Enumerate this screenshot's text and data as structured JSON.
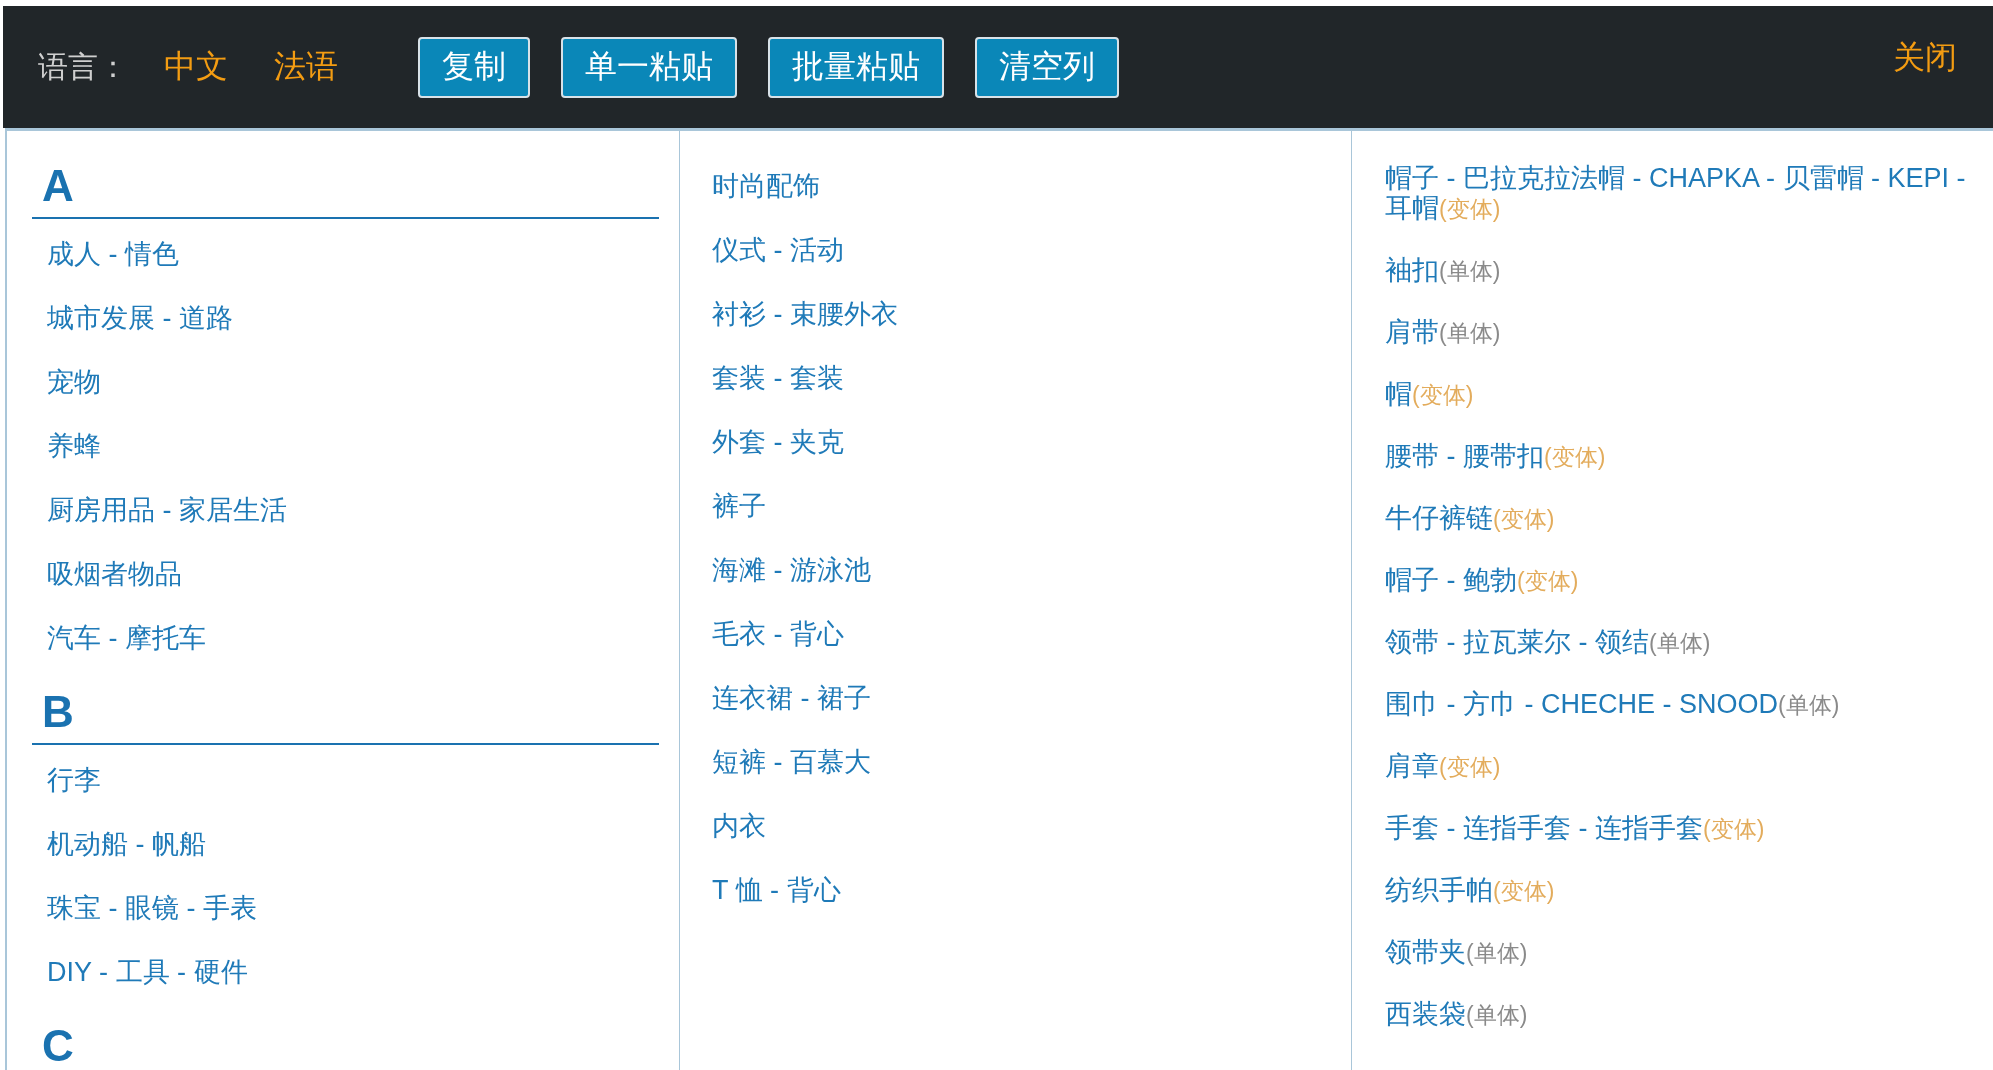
{
  "toolbar": {
    "language_label": "语言：",
    "languages": [
      "中文",
      "法语"
    ],
    "buttons": [
      "复制",
      "单一粘贴",
      "批量粘贴",
      "清空列"
    ],
    "close": "关闭"
  },
  "columns": [
    {
      "entries": [
        {
          "kind": "heading",
          "label": "A"
        },
        {
          "kind": "item",
          "label": "成人 - 情色"
        },
        {
          "kind": "item",
          "label": "城市发展 - 道路"
        },
        {
          "kind": "item",
          "label": "宠物"
        },
        {
          "kind": "item",
          "label": "养蜂"
        },
        {
          "kind": "item",
          "label": "厨房用品 - 家居生活"
        },
        {
          "kind": "item",
          "label": "吸烟者物品"
        },
        {
          "kind": "item",
          "label": "汽车 - 摩托车"
        },
        {
          "kind": "heading",
          "label": "B"
        },
        {
          "kind": "item",
          "label": "行李"
        },
        {
          "kind": "item",
          "label": "机动船 - 帆船"
        },
        {
          "kind": "item",
          "label": "珠宝 - 眼镜 - 手表"
        },
        {
          "kind": "item",
          "label": "DIY - 工具 - 硬件"
        },
        {
          "kind": "heading",
          "label": "C"
        }
      ]
    },
    {
      "entries": [
        {
          "kind": "item",
          "label": "时尚配饰"
        },
        {
          "kind": "item",
          "label": "仪式 - 活动"
        },
        {
          "kind": "item",
          "label": "衬衫 - 束腰外衣"
        },
        {
          "kind": "item",
          "label": "套装 - 套装"
        },
        {
          "kind": "item",
          "label": "外套 - 夹克"
        },
        {
          "kind": "item",
          "label": "裤子"
        },
        {
          "kind": "item",
          "label": "海滩 - 游泳池"
        },
        {
          "kind": "item",
          "label": "毛衣 - 背心"
        },
        {
          "kind": "item",
          "label": "连衣裙 - 裙子"
        },
        {
          "kind": "item",
          "label": "短裤 - 百慕大"
        },
        {
          "kind": "item",
          "label": "内衣"
        },
        {
          "kind": "item",
          "label": "T 恤 - 背心"
        }
      ]
    },
    {
      "entries": [
        {
          "kind": "item",
          "label": "帽子 - 巴拉克拉法帽 - CHAPKA - 贝雷帽 - KEPI - 耳帽",
          "tag": {
            "text": "(变体)",
            "kind": "variant"
          }
        },
        {
          "kind": "item",
          "label": "袖扣",
          "tag": {
            "text": "(单体)",
            "kind": "single"
          }
        },
        {
          "kind": "item",
          "label": "肩带",
          "tag": {
            "text": "(单体)",
            "kind": "single"
          }
        },
        {
          "kind": "item",
          "label": "帽",
          "tag": {
            "text": "(变体)",
            "kind": "variant"
          }
        },
        {
          "kind": "item",
          "label": "腰带 - 腰带扣",
          "tag": {
            "text": "(变体)",
            "kind": "variant"
          }
        },
        {
          "kind": "item",
          "label": "牛仔裤链",
          "tag": {
            "text": "(变体)",
            "kind": "variant"
          }
        },
        {
          "kind": "item",
          "label": "帽子 - 鲍勃",
          "tag": {
            "text": "(变体)",
            "kind": "variant"
          }
        },
        {
          "kind": "item",
          "label": "领带 - 拉瓦莱尔 - 领结",
          "tag": {
            "text": "(单体)",
            "kind": "single"
          }
        },
        {
          "kind": "item",
          "label": "围巾 - 方巾 - CHECHE - SNOOD",
          "tag": {
            "text": "(单体)",
            "kind": "single"
          }
        },
        {
          "kind": "item",
          "label": "肩章",
          "tag": {
            "text": "(变体)",
            "kind": "variant"
          }
        },
        {
          "kind": "item",
          "label": "手套 - 连指手套 - 连指手套",
          "tag": {
            "text": "(变体)",
            "kind": "variant"
          }
        },
        {
          "kind": "item",
          "label": "纺织手帕",
          "tag": {
            "text": "(变体)",
            "kind": "variant"
          }
        },
        {
          "kind": "item",
          "label": "领带夹",
          "tag": {
            "text": "(单体)",
            "kind": "single"
          }
        },
        {
          "kind": "item",
          "label": "西装袋",
          "tag": {
            "text": "(单体)",
            "kind": "single"
          }
        }
      ]
    }
  ]
}
